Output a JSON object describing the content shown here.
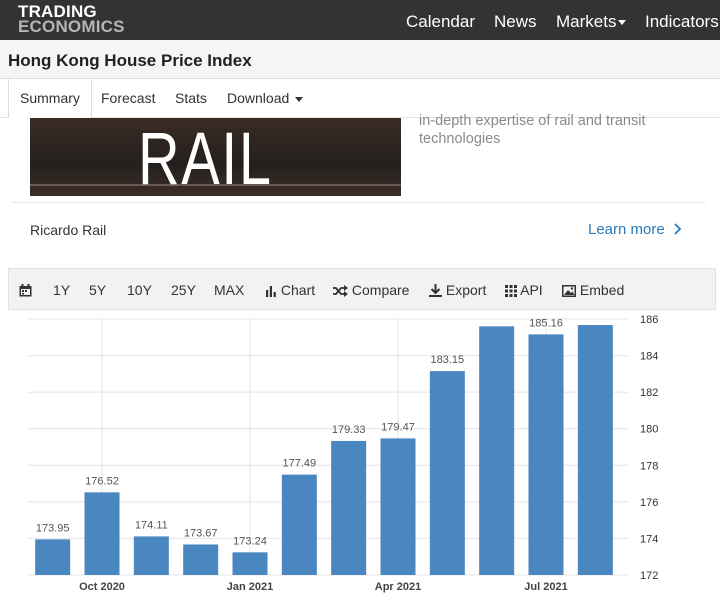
{
  "brand": {
    "line1": "TRADING",
    "line2": "ECONOMICS"
  },
  "nav": {
    "calendar": "Calendar",
    "news": "News",
    "markets": "Markets",
    "indicators": "Indicators"
  },
  "page_title": "Hong Kong House Price Index",
  "tabs": {
    "summary": "Summary",
    "forecast": "Forecast",
    "stats": "Stats",
    "download": "Download"
  },
  "ad": {
    "image_text": "RAIL",
    "text_line1": "in-depth expertise of rail and transit",
    "text_line2": "technologies",
    "advertiser": "Ricardo Rail",
    "cta": "Learn more"
  },
  "toolbar": {
    "r1y": "1Y",
    "r5y": "5Y",
    "r10y": "10Y",
    "r25y": "25Y",
    "max": "MAX",
    "chart": "Chart",
    "compare": "Compare",
    "export": "Export",
    "api": "API",
    "embed": "Embed"
  },
  "colors": {
    "topbar": "#333333",
    "bar": "#4a86c0",
    "link": "#2a7ab8"
  },
  "chart_data": {
    "type": "bar",
    "categories": [
      "Sep 2020",
      "Oct 2020",
      "Nov 2020",
      "Dec 2020",
      "Jan 2021",
      "Feb 2021",
      "Mar 2021",
      "Apr 2021",
      "May 2021",
      "Jun 2021",
      "Jul 2021",
      "Aug 2021"
    ],
    "values": [
      173.95,
      176.52,
      174.11,
      173.67,
      173.24,
      177.49,
      179.33,
      179.47,
      183.15,
      185.6,
      185.16,
      185.67
    ],
    "labels": [
      "173.95",
      "176.52",
      "174.11",
      "173.67",
      "173.24",
      "177.49",
      "179.33",
      "179.47",
      "183.15",
      "",
      "185.16",
      ""
    ],
    "x_tick_labels": [
      "Oct 2020",
      "Jan 2021",
      "Apr 2021",
      "Jul 2021"
    ],
    "y_ticks": [
      172,
      174,
      176,
      178,
      180,
      182,
      184,
      186
    ],
    "ylim": [
      172,
      186
    ],
    "y_axis_side": "right",
    "grid": true,
    "title": "",
    "xlabel": "",
    "ylabel": ""
  }
}
